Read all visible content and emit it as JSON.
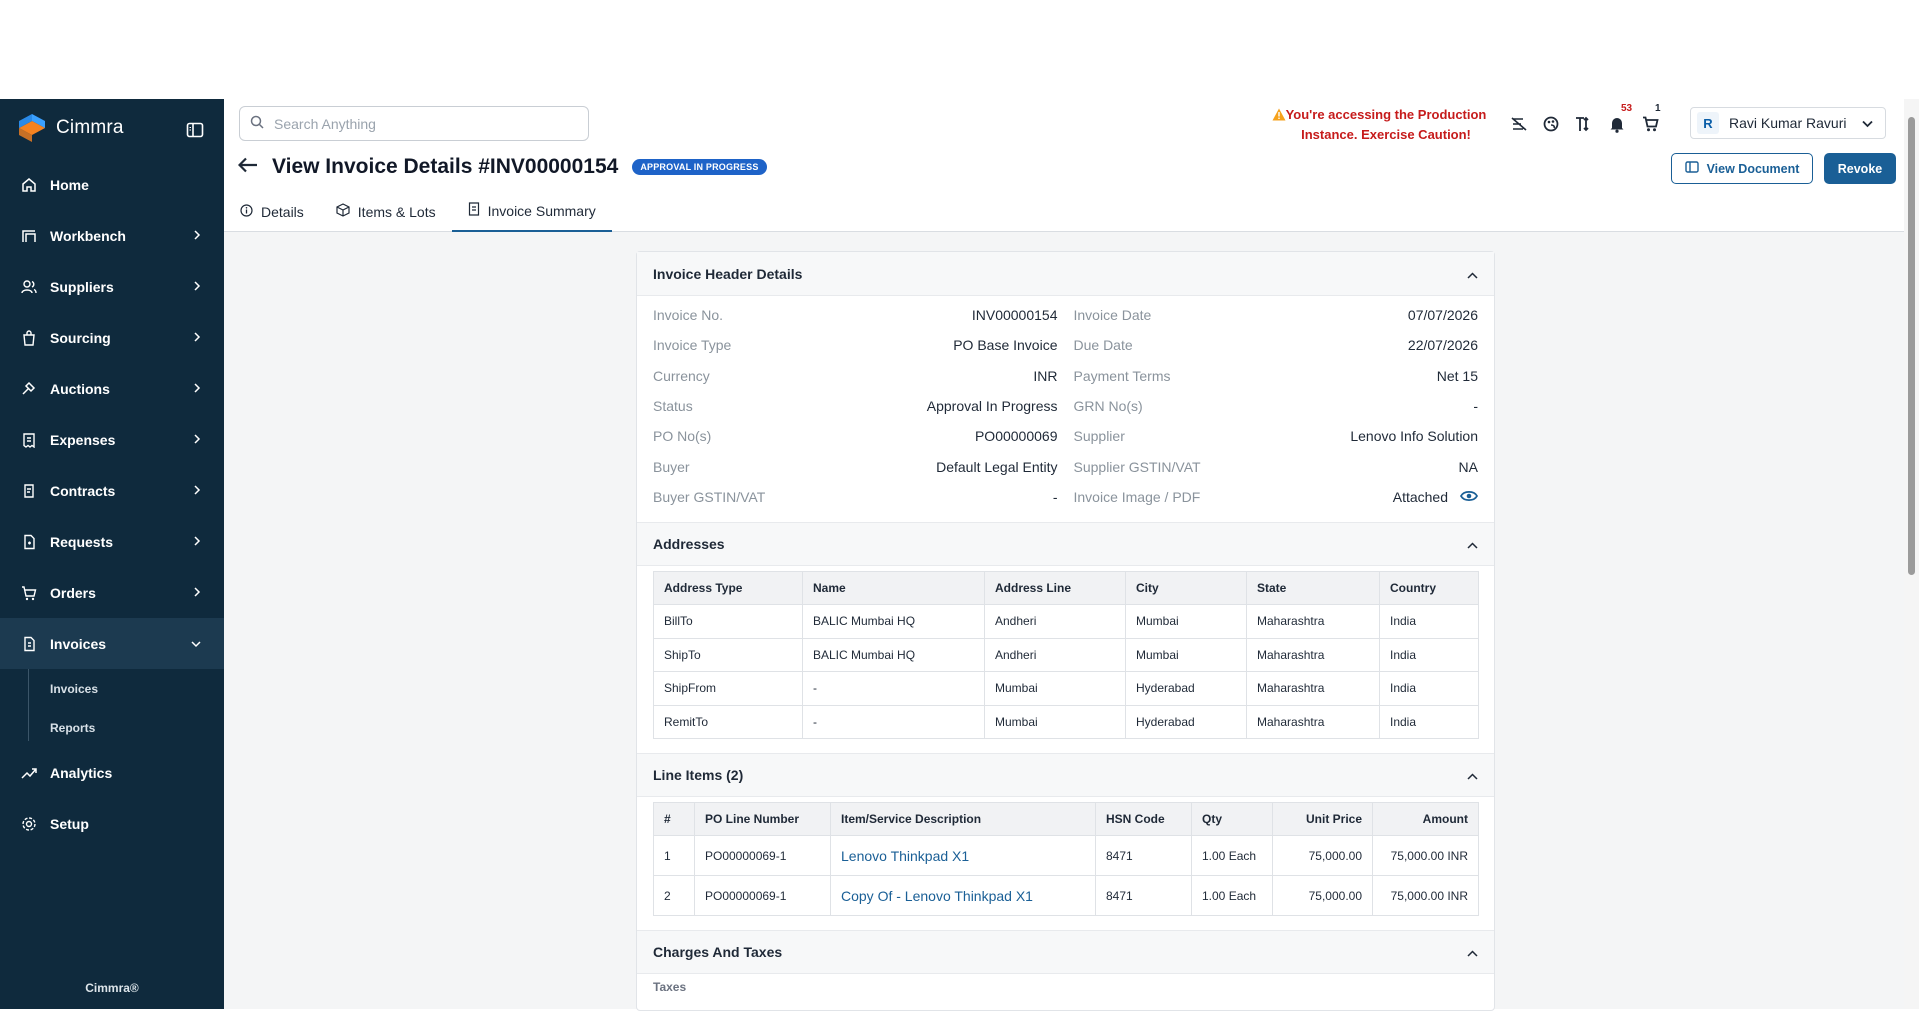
{
  "app": {
    "name": "Cimmra",
    "footer": "Cimmra®"
  },
  "sidebar": {
    "items": [
      {
        "label": "Home",
        "icon": "home-icon"
      },
      {
        "label": "Workbench",
        "icon": "workbench-icon"
      },
      {
        "label": "Suppliers",
        "icon": "users-icon"
      },
      {
        "label": "Sourcing",
        "icon": "bag-icon"
      },
      {
        "label": "Auctions",
        "icon": "gavel-icon"
      },
      {
        "label": "Expenses",
        "icon": "receipt-icon"
      },
      {
        "label": "Contracts",
        "icon": "contract-icon"
      },
      {
        "label": "Requests",
        "icon": "request-icon"
      },
      {
        "label": "Orders",
        "icon": "cart-icon"
      },
      {
        "label": "Invoices",
        "icon": "invoice-icon"
      },
      {
        "label": "Analytics",
        "icon": "trend-icon"
      },
      {
        "label": "Setup",
        "icon": "gear-icon"
      }
    ],
    "sub_items": [
      "Invoices",
      "Reports"
    ]
  },
  "header": {
    "search_placeholder": "Search Anything",
    "warning_line1": "You're accessing the Production",
    "warning_line2": "Instance. Exercise Caution!",
    "notification_count": "53",
    "cart_count": "1",
    "user_name": "Ravi Kumar Ravuri",
    "user_initial": "R"
  },
  "page": {
    "title": "View Invoice Details #INV00000154",
    "status": "APPROVAL IN PROGRESS",
    "view_document": "View Document",
    "revoke": "Revoke",
    "tabs": [
      "Details",
      "Items & Lots",
      "Invoice Summary"
    ]
  },
  "header_details": {
    "title": "Invoice Header Details",
    "left": [
      {
        "k": "Invoice No.",
        "v": "INV00000154"
      },
      {
        "k": "Invoice Type",
        "v": "PO Base Invoice"
      },
      {
        "k": "Currency",
        "v": "INR"
      },
      {
        "k": "Status",
        "v": "Approval In Progress"
      },
      {
        "k": "PO No(s)",
        "v": "PO00000069"
      },
      {
        "k": "Buyer",
        "v": "Default Legal Entity"
      },
      {
        "k": "Buyer GSTIN/VAT",
        "v": "-"
      }
    ],
    "right": [
      {
        "k": "Invoice Date",
        "v": "07/07/2026"
      },
      {
        "k": "Due Date",
        "v": "22/07/2026"
      },
      {
        "k": "Payment Terms",
        "v": "Net 15"
      },
      {
        "k": "GRN No(s)",
        "v": "-"
      },
      {
        "k": "Supplier",
        "v": "Lenovo Info Solution"
      },
      {
        "k": "Supplier GSTIN/VAT",
        "v": "NA"
      },
      {
        "k": "Invoice Image / PDF",
        "v": "Attached"
      }
    ]
  },
  "addresses": {
    "title": "Addresses",
    "columns": [
      "Address Type",
      "Name",
      "Address Line",
      "City",
      "State",
      "Country"
    ],
    "rows": [
      [
        "BillTo",
        "BALIC Mumbai HQ",
        "Andheri",
        "Mumbai",
        "Maharashtra",
        "India"
      ],
      [
        "ShipTo",
        "BALIC Mumbai HQ",
        "Andheri",
        "Mumbai",
        "Maharashtra",
        "India"
      ],
      [
        "ShipFrom",
        "-",
        "Mumbai",
        "Hyderabad",
        "Maharashtra",
        "India"
      ],
      [
        "RemitTo",
        "-",
        "Mumbai",
        "Hyderabad",
        "Maharashtra",
        "India"
      ]
    ]
  },
  "line_items": {
    "title": "Line Items (2)",
    "columns": [
      "#",
      "PO Line Number",
      "Item/Service Description",
      "HSN Code",
      "Qty",
      "Unit Price",
      "Amount"
    ],
    "rows": [
      [
        "1",
        "PO00000069-1",
        "Lenovo Thinkpad X1",
        "8471",
        "1.00 Each",
        "75,000.00",
        "75,000.00 INR"
      ],
      [
        "2",
        "PO00000069-1",
        "Copy Of - Lenovo Thinkpad X1",
        "8471",
        "1.00 Each",
        "75,000.00",
        "75,000.00 INR"
      ]
    ]
  },
  "charges": {
    "title": "Charges And Taxes",
    "sub": "Taxes"
  },
  "colors": {
    "sidebar": "#0f2a3d",
    "primary": "#1a5f96",
    "status": "#1e63c8",
    "warning": "#c61b1b"
  }
}
